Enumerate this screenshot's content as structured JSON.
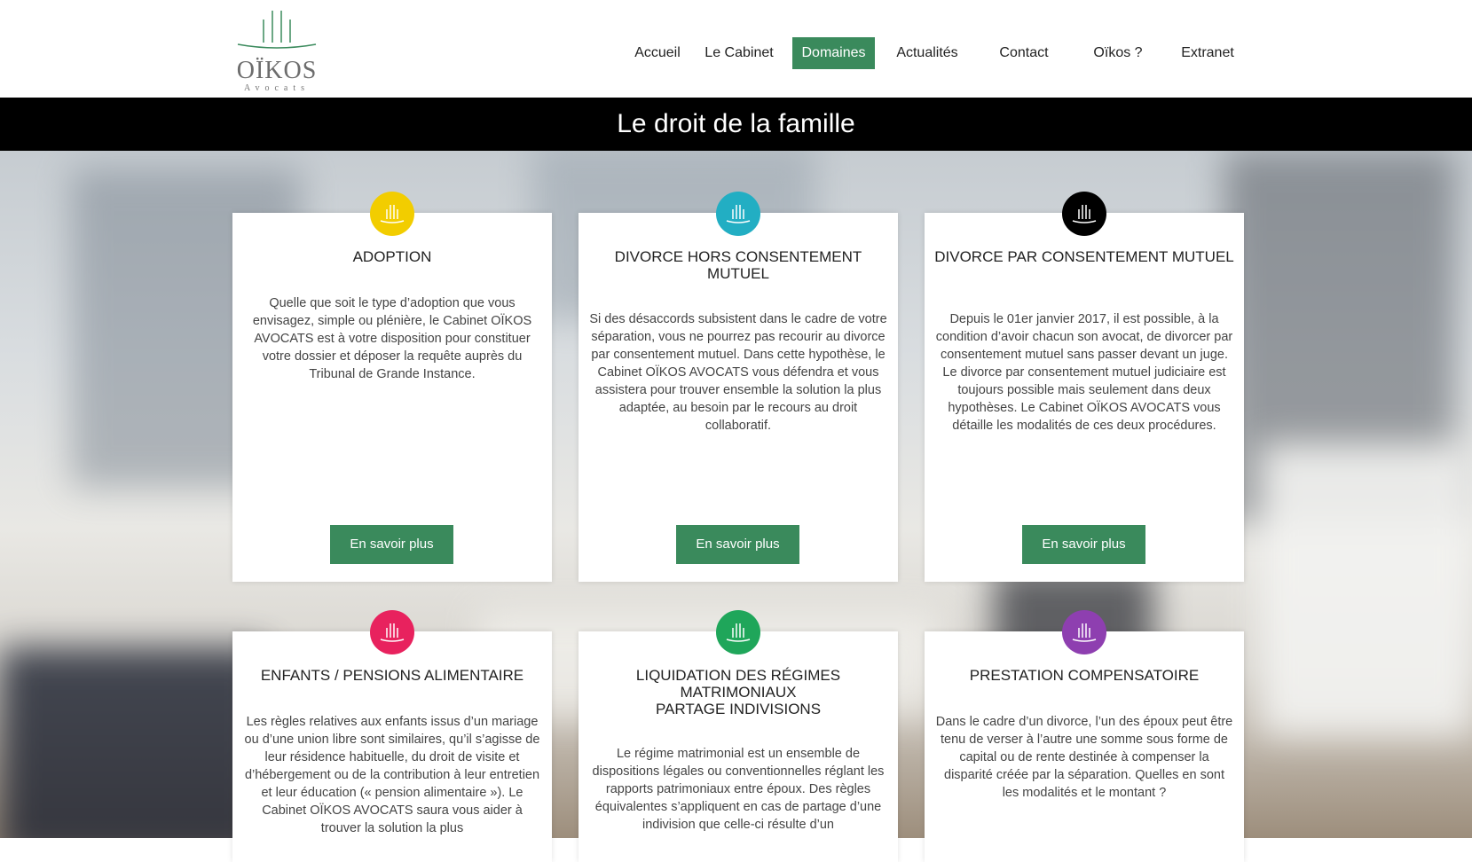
{
  "brand": {
    "name": "OÏKOS",
    "tagline": "Avocats",
    "accent_color": "#3a8a5c"
  },
  "nav": {
    "items": [
      {
        "label": "Accueil"
      },
      {
        "label": "Le Cabinet"
      },
      {
        "label": "Domaines",
        "active": true
      },
      {
        "label": "Actualités"
      },
      {
        "label": "Contact"
      },
      {
        "label": "Oïkos ?"
      },
      {
        "label": "Extranet"
      }
    ]
  },
  "page": {
    "title": "Le droit de la famille"
  },
  "cards": [
    {
      "title": "ADOPTION",
      "color": "#f2cd00",
      "text": "Quelle que soit le type d’adoption que vous envisagez, simple ou plénière, le Cabinet OÏKOS AVOCATS est à votre disposition pour constituer votre dossier et déposer la requête auprès du Tribunal de Grande Instance.",
      "button": "En savoir plus"
    },
    {
      "title": "DIVORCE HORS CONSENTEMENT MUTUEL",
      "color": "#22aec3",
      "text": "Si des désaccords subsistent dans le cadre de votre séparation, vous ne pourrez pas recourir au divorce par consentement mutuel. Dans cette hypothèse, le Cabinet OÏKOS AVOCATS vous défendra et vous assistera pour trouver ensemble la solution la plus adaptée, au besoin par le recours au droit collaboratif.",
      "button": "En savoir plus"
    },
    {
      "title": "DIVORCE PAR CONSENTEMENT MUTUEL",
      "color": "#000000",
      "text": "Depuis le 01er janvier 2017, il est possible, à la condition d’avoir chacun son avocat, de divorcer par consentement mutuel sans passer devant un juge. Le divorce par consentement mutuel judiciaire est toujours possible mais seulement dans deux hypothèses. Le Cabinet OÏKOS AVOCATS vous détaille les modalités de ces deux procédures.",
      "button": "En savoir plus"
    },
    {
      "title": "ENFANTS / PENSIONS ALIMENTAIRE",
      "color": "#e8225e",
      "text": "Les règles relatives aux enfants issus d’un mariage ou d’une union libre sont similaires, qu’il s’agisse de leur résidence habituelle, du droit de visite et d’hébergement ou de la contribution à leur entretien et leur éducation (« pension alimentaire »). Le Cabinet OÏKOS AVOCATS saura vous aider à trouver la solution la plus"
    },
    {
      "title_line1": "LIQUIDATION DES RÉGIMES MATRIMONIAUX",
      "title_line2": "PARTAGE INDIVISIONS",
      "color": "#1fa65a",
      "text": "Le régime matrimonial est un ensemble de dispositions légales ou conventionnelles réglant les rapports patrimoniaux entre époux. Des règles équivalentes s’appliquent en cas de partage d’une indivision que celle-ci résulte d’un"
    },
    {
      "title": "PRESTATION COMPENSATOIRE",
      "color": "#8e3fb0",
      "text": "Dans le cadre d’un divorce, l’un des époux peut être tenu de verser à l’autre une somme sous forme de capital ou de rente destinée à compenser la disparité créée par la séparation. Quelles en sont les modalités et le montant ?"
    }
  ]
}
